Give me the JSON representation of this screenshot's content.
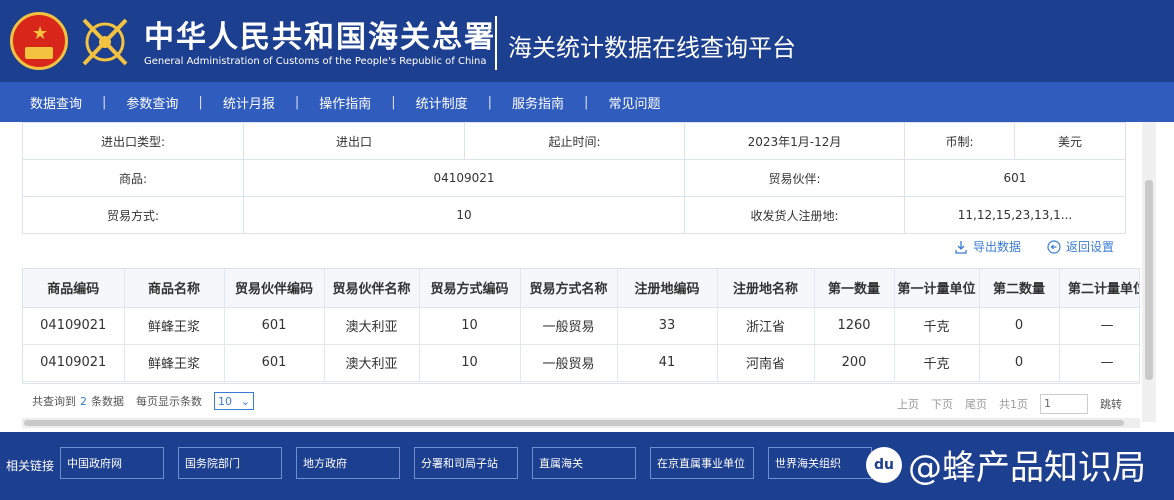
{
  "header": {
    "title_cn": "中华人民共和国海关总署",
    "title_en": "General Administration of Customs of the People's Republic of China",
    "platform_title": "海关统计数据在线查询平台"
  },
  "nav": {
    "items": [
      "数据查询",
      "参数查询",
      "统计月报",
      "操作指南",
      "统计制度",
      "服务指南",
      "常见问题"
    ],
    "separator": "|"
  },
  "query_info": {
    "row1": {
      "l1": "进出口类型:",
      "v1": "进出口",
      "l2": "起止时间:",
      "v2": "2023年1月-12月",
      "l3": "币制:",
      "v3": "美元"
    },
    "row2": {
      "l1": "商品:",
      "v1": "04109021",
      "l2": "贸易伙伴:",
      "v2": "601"
    },
    "row3": {
      "l1": "贸易方式:",
      "v1": "10",
      "l2": "收发货人注册地:",
      "v2": "11,12,15,23,13,1..."
    }
  },
  "actions": {
    "export": "导出数据",
    "reset": "返回设置"
  },
  "results": {
    "columns": [
      "商品编码",
      "商品名称",
      "贸易伙伴编码",
      "贸易伙伴名称",
      "贸易方式编码",
      "贸易方式名称",
      "注册地编码",
      "注册地名称",
      "第一数量",
      "第一计量单位",
      "第二数量",
      "第二计量单位"
    ],
    "rows": [
      [
        "04109021",
        "鲜蜂王浆",
        "601",
        "澳大利亚",
        "10",
        "一般贸易",
        "33",
        "浙江省",
        "1260",
        "千克",
        "0",
        "—"
      ],
      [
        "04109021",
        "鲜蜂王浆",
        "601",
        "澳大利亚",
        "10",
        "一般贸易",
        "41",
        "河南省",
        "200",
        "千克",
        "0",
        "—"
      ]
    ]
  },
  "pager": {
    "total_prefix": "共查询到",
    "total_count": "2",
    "total_suffix": "条数据",
    "page_size_label": "每页显示条数",
    "page_size": "10",
    "first": "上页",
    "prev": "下页",
    "last": "尾页",
    "total_pages": "共1页",
    "page_input": "1",
    "jump": "跳转"
  },
  "footer": {
    "label": "相关链接",
    "links": [
      "中国政府网",
      "国务院部门",
      "地方政府",
      "分署和司局子站",
      "直属海关",
      "在京直属事业单位",
      "世界海关组织"
    ],
    "watermark": "@蜂产品知识局",
    "watermark_badge": "du"
  },
  "colors": {
    "header_bg": "#1d3f8f",
    "nav_bg": "#2f5cbd",
    "link_blue": "#3a7bd5"
  }
}
